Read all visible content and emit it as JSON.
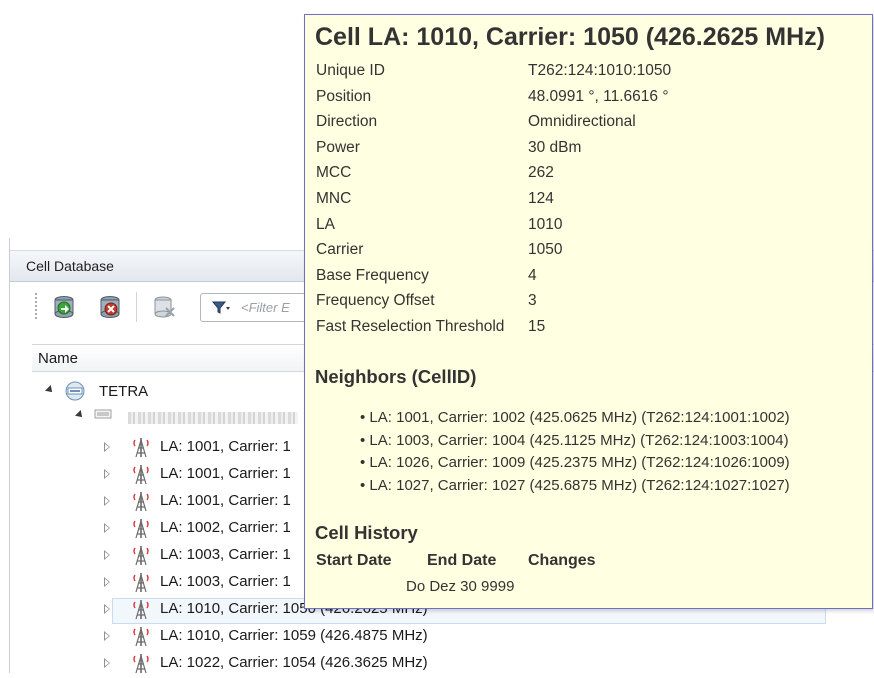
{
  "panel": {
    "title": "Cell Database",
    "filter_placeholder": "<Filter E",
    "column_header": "Name"
  },
  "tree": {
    "root_label": "TETRA",
    "cells": [
      {
        "label": "LA: 1001, Carrier: 1",
        "selected": false
      },
      {
        "label": "LA: 1001, Carrier: 1",
        "selected": false
      },
      {
        "label": "LA: 1001, Carrier: 1",
        "selected": false
      },
      {
        "label": "LA: 1002, Carrier: 1",
        "selected": false
      },
      {
        "label": "LA: 1003, Carrier: 1",
        "selected": false
      },
      {
        "label": "LA: 1003, Carrier: 1",
        "selected": false
      },
      {
        "label": "LA: 1010, Carrier: 1050 (426.2625 MHz)",
        "selected": true
      },
      {
        "label": "LA: 1010, Carrier: 1059 (426.4875 MHz)",
        "selected": false
      },
      {
        "label": "LA: 1022, Carrier: 1054 (426.3625 MHz)",
        "selected": false
      }
    ]
  },
  "tooltip": {
    "title": "Cell LA: 1010, Carrier: 1050 (426.2625 MHz)",
    "properties": [
      {
        "label": "Unique ID",
        "value": "T262:124:1010:1050"
      },
      {
        "label": "Position",
        "value": "48.0991 °, 11.6616 °"
      },
      {
        "label": "Direction",
        "value": "Omnidirectional"
      },
      {
        "label": "Power",
        "value": "30 dBm"
      },
      {
        "label": "MCC",
        "value": "262"
      },
      {
        "label": "MNC",
        "value": "124"
      },
      {
        "label": "LA",
        "value": "1010"
      },
      {
        "label": "Carrier",
        "value": "1050"
      },
      {
        "label": "Base Frequency",
        "value": "4"
      },
      {
        "label": "Frequency Offset",
        "value": "3"
      },
      {
        "label": "Fast Reselection Threshold",
        "value": "15"
      }
    ],
    "neighbors_title": "Neighbors (CellID)",
    "neighbors": [
      "LA: 1001, Carrier: 1002 (425.0625 MHz) (T262:124:1001:1002)",
      "LA: 1003, Carrier: 1004 (425.1125 MHz) (T262:124:1003:1004)",
      "LA: 1026, Carrier: 1009 (425.2375 MHz) (T262:124:1026:1009)",
      "LA: 1027, Carrier: 1027 (425.6875 MHz) (T262:124:1027:1027)"
    ],
    "history_title": "Cell History",
    "history_headers": [
      "Start Date",
      "End Date",
      "Changes"
    ],
    "history_rows": [
      {
        "start": "",
        "end": "Do Dez 30 9999",
        "changes": ""
      }
    ]
  },
  "colors": {
    "tooltip_bg": "#ffffe1",
    "tooltip_border": "#6f6fc8",
    "selection_bg": "#f2f7fc"
  }
}
